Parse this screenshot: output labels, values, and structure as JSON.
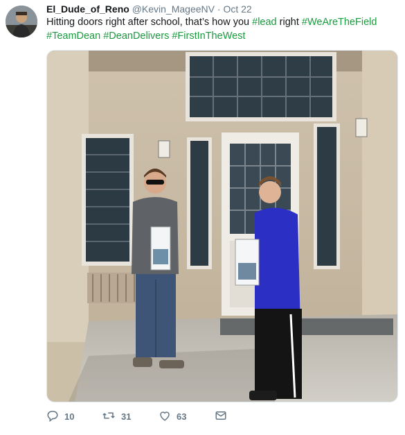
{
  "tweet": {
    "display_name": "El_Dude_of_Reno",
    "handle": "@Kevin_MageeNV",
    "separator": "·",
    "time": "Oct 22",
    "text_prefix": "Hitting doors right after school, that’s how you ",
    "hashtag_lead": "#lead",
    "text_mid": " right ",
    "hashtag_1": "#WeAreTheField",
    "hashtag_2": "#TeamDean",
    "hashtag_3": "#DeanDelivers",
    "hashtag_4": "#FirstInTheWest"
  },
  "actions": {
    "reply_count": "10",
    "retweet_count": "31",
    "like_count": "63"
  },
  "icons": [
    "reply-icon",
    "retweet-icon",
    "like-icon",
    "direct-message-icon"
  ],
  "colors": {
    "hashtag": "#1b9a3f",
    "meta": "#657786"
  }
}
